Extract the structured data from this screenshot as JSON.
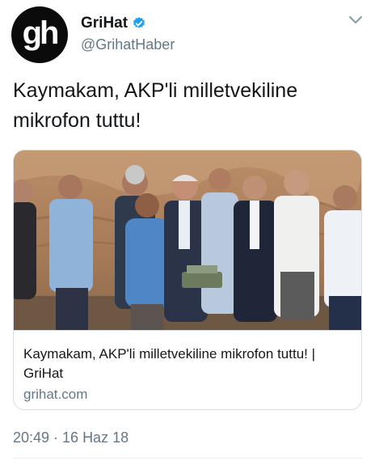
{
  "account": {
    "avatar_mark": "gh",
    "display_name": "GriHat",
    "handle": "@GrihatHaber",
    "verified_icon": "verified-badge-icon",
    "menu_icon": "chevron-down-icon"
  },
  "tweet": {
    "text": "Kaymakam, AKP'li milletvekiline mikrofon tuttu!",
    "timestamp": "20:49 · 16 Haz 18"
  },
  "card": {
    "image_description_icon": "photo",
    "title": "Kaymakam, AKP'li milletvekiline mikrofon tuttu! | GriHat",
    "domain": "grihat.com"
  },
  "colors": {
    "primary_text": "#14171a",
    "secondary_text": "#657786",
    "verified_blue": "#1da1f2",
    "border": "#d8dee3"
  }
}
